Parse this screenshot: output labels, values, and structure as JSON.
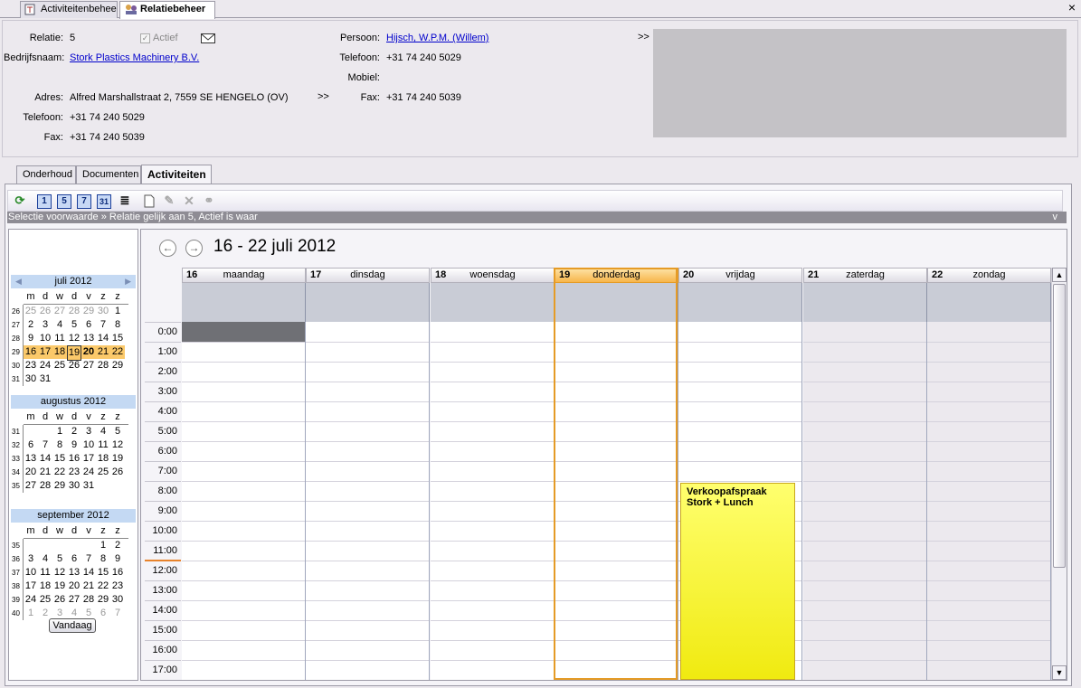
{
  "tabs": [
    {
      "label": "Activiteitenbeheer"
    },
    {
      "label": "Relatiebeheer"
    }
  ],
  "close_label": "×",
  "relation": {
    "relatie_label": "Relatie:",
    "relatie_value": "5",
    "actief_label": "Actief",
    "bedrijfsnaam_label": "Bedrijfsnaam:",
    "bedrijfsnaam_value": "Stork Plastics Machinery B.V.",
    "adres_label": "Adres:",
    "adres_value": "Alfred Marshallstraat 2, 7559 SE HENGELO (OV)",
    "telefoon_label": "Telefoon:",
    "telefoon_value": "+31 74 240 5029",
    "fax_label": "Fax:",
    "fax_value": "+31 74 240 5039",
    "more1": ">>",
    "persoon_label": "Persoon:",
    "persoon_value": "Hijsch, W.P.M. (Willem)",
    "ptelefoon_label": "Telefoon:",
    "ptelefoon_value": "+31 74 240 5029",
    "mobiel_label": "Mobiel:",
    "pfax_label": "Fax:",
    "pfax_value": "+31 74 240 5039",
    "more2": ">>"
  },
  "inner_tabs": [
    {
      "label": "Onderhoud"
    },
    {
      "label": "Documenten"
    },
    {
      "label": "Activiteiten"
    }
  ],
  "toolbar": {
    "day1": "1",
    "day5": "5",
    "day7": "7",
    "day31": "31"
  },
  "condition": {
    "text": "Selectie voorwaarde » Relatie gelijk aan 5, Actief is waar",
    "toggle": "v"
  },
  "minical": {
    "weekdays": [
      "m",
      "d",
      "w",
      "d",
      "v",
      "z",
      "z"
    ],
    "months": [
      {
        "title": "juli 2012",
        "weeks": [
          [
            "26",
            "25",
            "26",
            "27",
            "28",
            "29",
            "30",
            "1"
          ],
          [
            "27",
            "2",
            "3",
            "4",
            "5",
            "6",
            "7",
            "8"
          ],
          [
            "28",
            "9",
            "10",
            "11",
            "12",
            "13",
            "14",
            "15"
          ],
          [
            "29",
            "16",
            "17",
            "18",
            "19",
            "20",
            "21",
            "22"
          ],
          [
            "30",
            "23",
            "24",
            "25",
            "26",
            "27",
            "28",
            "29"
          ],
          [
            "31",
            "30",
            "31",
            "",
            "",
            "",
            "",
            ""
          ]
        ]
      },
      {
        "title": "augustus 2012",
        "weeks": [
          [
            "31",
            "",
            "",
            "1",
            "2",
            "3",
            "4",
            "5"
          ],
          [
            "32",
            "6",
            "7",
            "8",
            "9",
            "10",
            "11",
            "12"
          ],
          [
            "33",
            "13",
            "14",
            "15",
            "16",
            "17",
            "18",
            "19"
          ],
          [
            "34",
            "20",
            "21",
            "22",
            "23",
            "24",
            "25",
            "26"
          ],
          [
            "35",
            "27",
            "28",
            "29",
            "30",
            "31",
            "",
            ""
          ]
        ]
      },
      {
        "title": "september 2012",
        "weeks": [
          [
            "35",
            "",
            "",
            "",
            "",
            "",
            "1",
            "2"
          ],
          [
            "36",
            "3",
            "4",
            "5",
            "6",
            "7",
            "8",
            "9"
          ],
          [
            "37",
            "10",
            "11",
            "12",
            "13",
            "14",
            "15",
            "16"
          ],
          [
            "38",
            "17",
            "18",
            "19",
            "20",
            "21",
            "22",
            "23"
          ],
          [
            "39",
            "24",
            "25",
            "26",
            "27",
            "28",
            "29",
            "30"
          ],
          [
            "40",
            "1",
            "2",
            "3",
            "4",
            "5",
            "6",
            "7"
          ]
        ]
      }
    ],
    "today_button": "Vandaag"
  },
  "scheduler": {
    "range": "16 - 22 juli 2012",
    "days": [
      {
        "num": "16",
        "name": "maandag"
      },
      {
        "num": "17",
        "name": "dinsdag"
      },
      {
        "num": "18",
        "name": "woensdag"
      },
      {
        "num": "19",
        "name": "donderdag"
      },
      {
        "num": "20",
        "name": "vrijdag"
      },
      {
        "num": "21",
        "name": "zaterdag"
      },
      {
        "num": "22",
        "name": "zondag"
      }
    ],
    "hours": [
      "0:00",
      "1:00",
      "2:00",
      "3:00",
      "4:00",
      "5:00",
      "6:00",
      "7:00",
      "8:00",
      "9:00",
      "10:00",
      "11:00",
      "12:00",
      "13:00",
      "14:00",
      "15:00",
      "16:00",
      "17:00"
    ],
    "event": {
      "title": "Verkoopafspraak Stork + Lunch",
      "day": "vrijdag",
      "start": "8:00"
    },
    "colors": {
      "event": "#ffff6e",
      "today": "#f7b54b",
      "weekend": "#ece9ee"
    }
  }
}
